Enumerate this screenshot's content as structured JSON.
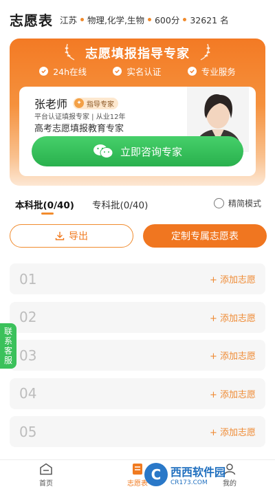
{
  "header": {
    "title": "志愿表",
    "province": "江苏",
    "subjects": "物理,化学,生物",
    "score": "600分",
    "rank": "32621 名"
  },
  "banner": {
    "title": "志愿填报指导专家",
    "features": [
      "24h在线",
      "实名认证",
      "专业服务"
    ],
    "expert": {
      "name": "张老师",
      "badge": "指导专家",
      "subtitle": "平台认证填报专家 | 从业12年",
      "description": "高考志愿填报教育专家"
    },
    "consult_button": "立即咨询专家"
  },
  "tabs": {
    "items": [
      "本科批(0/40)",
      "专科批(0/40)"
    ],
    "active_index": 0,
    "simple_mode_label": "精简模式"
  },
  "actions": {
    "export_label": "导出",
    "custom_label": "定制专属志愿表"
  },
  "slots": [
    {
      "num": "01",
      "add": "+ 添加志愿"
    },
    {
      "num": "02",
      "add": "+ 添加志愿"
    },
    {
      "num": "03",
      "add": "+ 添加志愿"
    },
    {
      "num": "04",
      "add": "+ 添加志愿"
    },
    {
      "num": "05",
      "add": "+ 添加志愿"
    }
  ],
  "side_tab": "联系客服",
  "bottom_nav": {
    "items": [
      {
        "label": "首页",
        "icon": "home-icon"
      },
      {
        "label": "志愿表",
        "icon": "form-icon"
      },
      {
        "label": "我的",
        "icon": "profile-icon"
      }
    ],
    "active_index": 1
  },
  "watermark": {
    "main": "西西软件园",
    "sub": "CR173.COM"
  },
  "colors": {
    "accent": "#f07620",
    "consult_green": "#2fb452",
    "slot_bg": "#f6f6f6"
  }
}
